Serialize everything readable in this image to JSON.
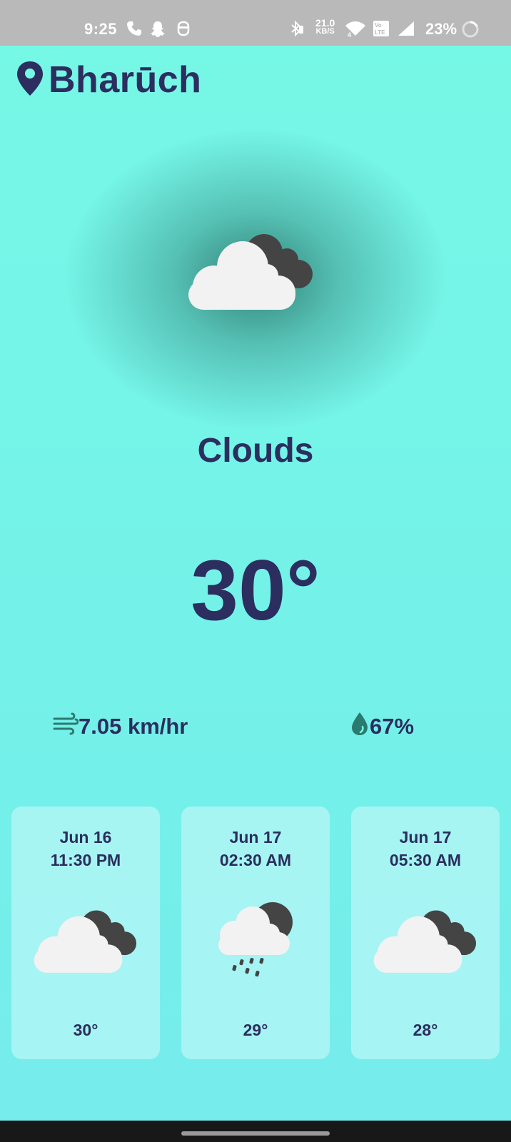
{
  "status_bar": {
    "time": "9:25",
    "net_speed_value": "21.0",
    "net_speed_unit": "KB/S",
    "battery": "23%",
    "icons": [
      "phone-icon",
      "snapchat-icon",
      "screen-recorder-icon",
      "bluetooth-icon",
      "wifi-icon",
      "volte-icon",
      "signal-icon",
      "battery-icon"
    ]
  },
  "location": {
    "city": "Bharūch",
    "icon": "location-pin-icon"
  },
  "current": {
    "icon": "cloudy-icon",
    "condition": "Clouds",
    "temperature": "30°",
    "wind": "7.05 km/hr",
    "humidity": "67%",
    "wind_icon": "wind-icon",
    "humidity_icon": "water-drop-icon"
  },
  "forecast": [
    {
      "date": "Jun 16",
      "time": "11:30 PM",
      "icon": "cloudy-icon",
      "temp": "30°"
    },
    {
      "date": "Jun 17",
      "time": "02:30 AM",
      "icon": "night-rain-icon",
      "temp": "29°"
    },
    {
      "date": "Jun 17",
      "time": "05:30 AM",
      "icon": "cloudy-icon",
      "temp": "28°"
    }
  ],
  "colors": {
    "background": "#76f8e6",
    "text": "#2b2e5e",
    "card": "#cdfafa",
    "cloud_light": "#f2f2f2",
    "cloud_dark": "#444444"
  }
}
